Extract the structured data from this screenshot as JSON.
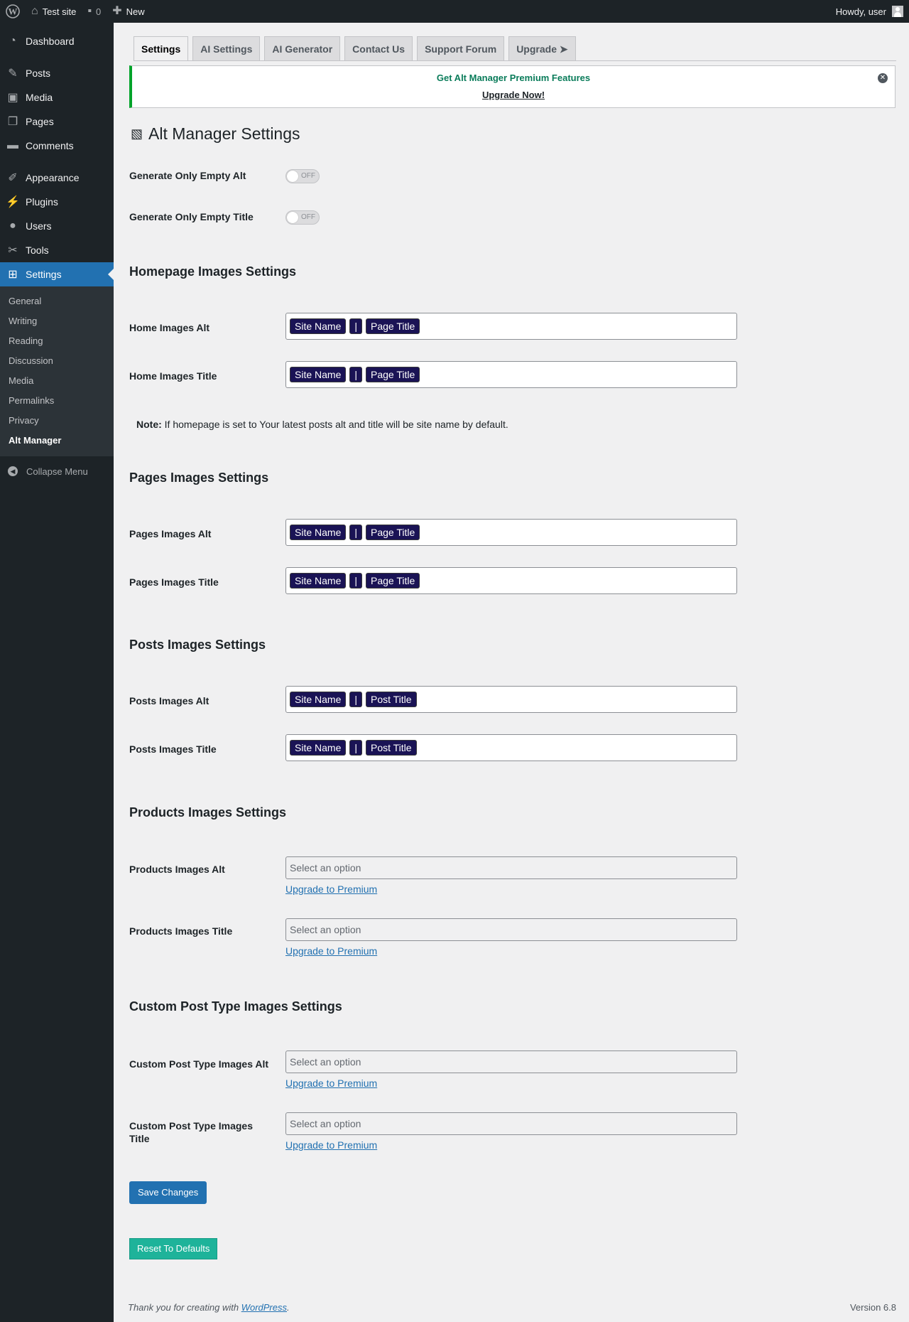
{
  "adminbar": {
    "site_name": "Test site",
    "comments_count": "0",
    "new_label": "New",
    "howdy": "Howdy, user"
  },
  "sidebar": {
    "items": [
      {
        "label": "Dashboard",
        "icon": "dashboard-icon"
      },
      {
        "label": "Posts",
        "icon": "pin-icon"
      },
      {
        "label": "Media",
        "icon": "media-icon"
      },
      {
        "label": "Pages",
        "icon": "pages-icon"
      },
      {
        "label": "Comments",
        "icon": "comments-icon"
      },
      {
        "label": "Appearance",
        "icon": "brush-icon"
      },
      {
        "label": "Plugins",
        "icon": "plug-icon"
      },
      {
        "label": "Users",
        "icon": "users-icon"
      },
      {
        "label": "Tools",
        "icon": "wrench-icon"
      },
      {
        "label": "Settings",
        "icon": "settings-icon"
      }
    ],
    "submenu": [
      "General",
      "Writing",
      "Reading",
      "Discussion",
      "Media",
      "Permalinks",
      "Privacy",
      "Alt Manager"
    ],
    "collapse_label": "Collapse Menu"
  },
  "tabs": [
    "Settings",
    "AI Settings",
    "AI Generator",
    "Contact Us",
    "Support Forum",
    "Upgrade ➤"
  ],
  "notice": {
    "title": "Get Alt Manager Premium Features",
    "link": "Upgrade Now!"
  },
  "page_title": "Alt Manager Settings",
  "toggles": {
    "empty_alt_label": "Generate Only Empty Alt",
    "empty_title_label": "Generate Only Empty Title",
    "state": "OFF"
  },
  "homepage": {
    "section_title": "Homepage Images Settings",
    "alt_label": "Home Images Alt",
    "title_label": "Home Images Title",
    "alt_tags": [
      "Site Name",
      "|",
      "Page Title"
    ],
    "title_tags": [
      "Site Name",
      "|",
      "Page Title"
    ],
    "note_bold": "Note:",
    "note_text": " If homepage is set to Your latest posts alt and title will be site name by default."
  },
  "pages": {
    "section_title": "Pages Images Settings",
    "alt_label": "Pages Images Alt",
    "title_label": "Pages Images Title",
    "alt_tags": [
      "Site Name",
      "|",
      "Page Title"
    ],
    "title_tags": [
      "Site Name",
      "|",
      "Page Title"
    ]
  },
  "posts": {
    "section_title": "Posts Images Settings",
    "alt_label": "Posts Images Alt",
    "title_label": "Posts Images Title",
    "alt_tags": [
      "Site Name",
      "|",
      "Post Title"
    ],
    "title_tags": [
      "Site Name",
      "|",
      "Post Title"
    ]
  },
  "products": {
    "section_title": "Products Images Settings",
    "alt_label": "Products Images Alt",
    "title_label": "Products Images Title"
  },
  "cpt": {
    "section_title": "Custom Post Type Images Settings",
    "alt_label": "Custom Post Type Images Alt",
    "title_label": "Custom Post Type Images Title"
  },
  "select_placeholder": "Select an option",
  "upgrade_link": "Upgrade to Premium",
  "buttons": {
    "save": "Save Changes",
    "reset": "Reset To Defaults"
  },
  "footer": {
    "thanks_prefix": "Thank you for creating with ",
    "thanks_link": "WordPress",
    "thanks_suffix": ".",
    "version": "Version 6.8"
  }
}
